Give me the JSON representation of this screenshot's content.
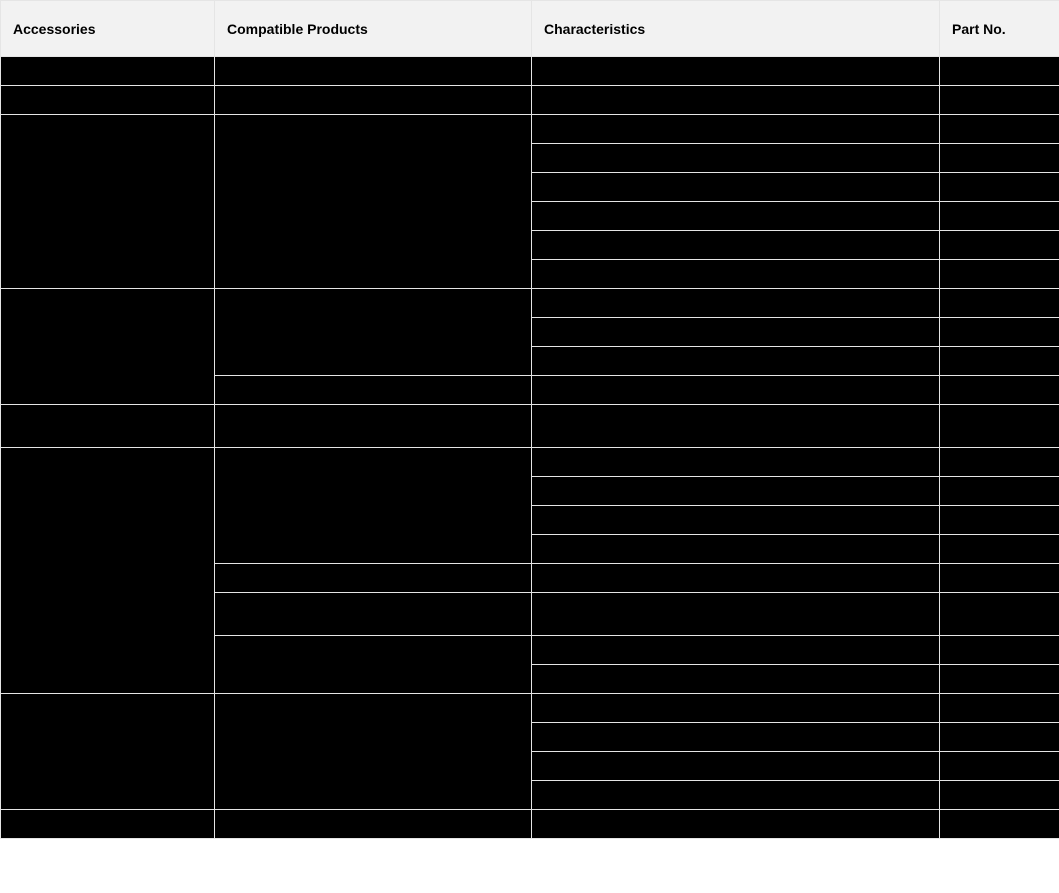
{
  "headers": {
    "col1": "Accessories",
    "col2": "Compatible Products",
    "col3": "Characteristics",
    "col4": "Part No."
  },
  "rows": [
    {
      "accessory": "",
      "compat": "",
      "chars": [
        {
          "text": "",
          "part": ""
        }
      ]
    },
    {
      "accessory": "",
      "compat": "",
      "chars": [
        {
          "text": "",
          "part": ""
        }
      ]
    },
    {
      "accessory": "",
      "compat": "",
      "chars": [
        {
          "text": "",
          "part": ""
        },
        {
          "text": "",
          "part": ""
        },
        {
          "text": "",
          "part": ""
        },
        {
          "text": "",
          "part": ""
        },
        {
          "text": "",
          "part": ""
        },
        {
          "text": "",
          "part": ""
        }
      ]
    },
    {
      "accessory": "",
      "compatGroups": [
        {
          "compat": "",
          "chars": [
            {
              "text": "",
              "part": ""
            },
            {
              "text": "",
              "part": ""
            },
            {
              "text": "",
              "part": ""
            }
          ]
        },
        {
          "compat": "",
          "chars": [
            {
              "text": "",
              "part": ""
            }
          ]
        }
      ]
    },
    {
      "accessory": "",
      "compat": "",
      "chars": [
        {
          "text": "",
          "part": ""
        }
      ],
      "tall": true
    },
    {
      "accessory": "",
      "compatGroups": [
        {
          "compat": "",
          "chars": [
            {
              "text": "",
              "part": ""
            },
            {
              "text": "",
              "part": ""
            },
            {
              "text": "",
              "part": ""
            },
            {
              "text": "",
              "part": ""
            }
          ]
        },
        {
          "compat": "",
          "chars": [
            {
              "text": "",
              "part": ""
            }
          ]
        },
        {
          "compat": "",
          "chars": [
            {
              "text": "",
              "part": ""
            }
          ],
          "tall": true
        },
        {
          "compat": "",
          "chars": [
            {
              "text": "",
              "part": ""
            },
            {
              "text": "",
              "part": ""
            }
          ]
        }
      ]
    },
    {
      "accessory": "",
      "compat": "",
      "chars": [
        {
          "text": "",
          "part": ""
        },
        {
          "text": "",
          "part": ""
        },
        {
          "text": "",
          "part": ""
        },
        {
          "text": "",
          "part": ""
        }
      ]
    },
    {
      "accessory": "",
      "compat": "",
      "chars": [
        {
          "text": "",
          "part": ""
        }
      ]
    }
  ]
}
